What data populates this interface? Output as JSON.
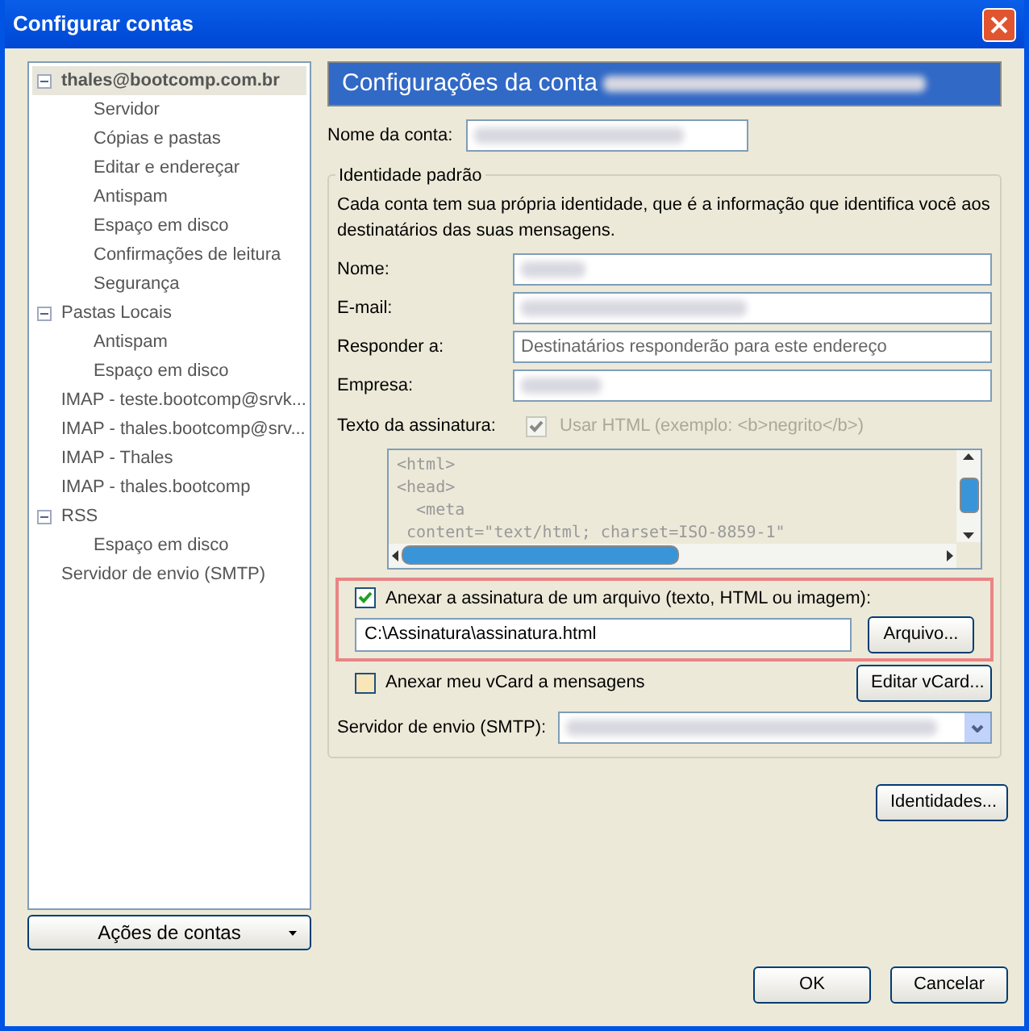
{
  "window": {
    "title": "Configurar contas"
  },
  "tree": [
    {
      "label": "thales@bootcomp.com.br",
      "selected": true,
      "expanded": true,
      "children": [
        {
          "label": "Servidor",
          "selected": false
        },
        {
          "label": "Cópias e pastas",
          "selected": false
        },
        {
          "label": "Editar e endereçar",
          "selected": false
        },
        {
          "label": "Antispam",
          "selected": false
        },
        {
          "label": "Espaço em disco",
          "selected": false
        },
        {
          "label": "Confirmações de leitura",
          "selected": false
        },
        {
          "label": "Segurança",
          "selected": false
        }
      ]
    },
    {
      "label": "Pastas Locais",
      "selected": false,
      "expanded": true,
      "children": [
        {
          "label": "Antispam",
          "selected": false
        },
        {
          "label": "Espaço em disco",
          "selected": false
        }
      ]
    },
    {
      "label": "IMAP - teste.bootcomp@srvk...",
      "selected": false
    },
    {
      "label": "IMAP - thales.bootcomp@srv...",
      "selected": false
    },
    {
      "label": "IMAP - Thales",
      "selected": false
    },
    {
      "label": "IMAP - thales.bootcomp",
      "selected": false
    },
    {
      "label": "RSS",
      "selected": false,
      "expanded": true,
      "children": [
        {
          "label": "Espaço em disco",
          "selected": false
        }
      ]
    },
    {
      "label": "Servidor de envio (SMTP)",
      "selected": false
    }
  ],
  "account_actions_button": "Ações de contas",
  "panel_title": "Configurações da conta",
  "account_name_label": "Nome da conta:",
  "identity": {
    "legend": "Identidade padrão",
    "description": "Cada conta tem sua própria identidade, que é a informação que identifica você aos destinatários das suas mensagens.",
    "fields": [
      {
        "label": "Nome:"
      },
      {
        "label": "E-mail:"
      },
      {
        "label": "Responder a:",
        "placeholder": "Destinatários responderão para este endereço"
      },
      {
        "label": "Empresa:"
      }
    ],
    "signature_label": "Texto da assinatura:",
    "use_html": {
      "label": "Usar HTML (exemplo: <b>negrito</b>)",
      "checked": true,
      "disabled": true
    },
    "signature_lines": [
      "<html>",
      "<head>",
      "  <meta",
      " content=\"text/html; charset=ISO-8859-1\""
    ],
    "attach_signature": {
      "label": "Anexar a assinatura de um arquivo (texto, HTML ou imagem):",
      "checked": true,
      "value": "C:\\Assinatura\\assinatura.html",
      "button": "Arquivo..."
    },
    "attach_vcard": {
      "label": "Anexar meu vCard a mensagens",
      "checked": false,
      "button": "Editar vCard..."
    },
    "smtp_label": "Servidor de envio (SMTP):"
  },
  "identities_button": "Identidades...",
  "buttons": [
    "OK",
    "Cancelar"
  ]
}
